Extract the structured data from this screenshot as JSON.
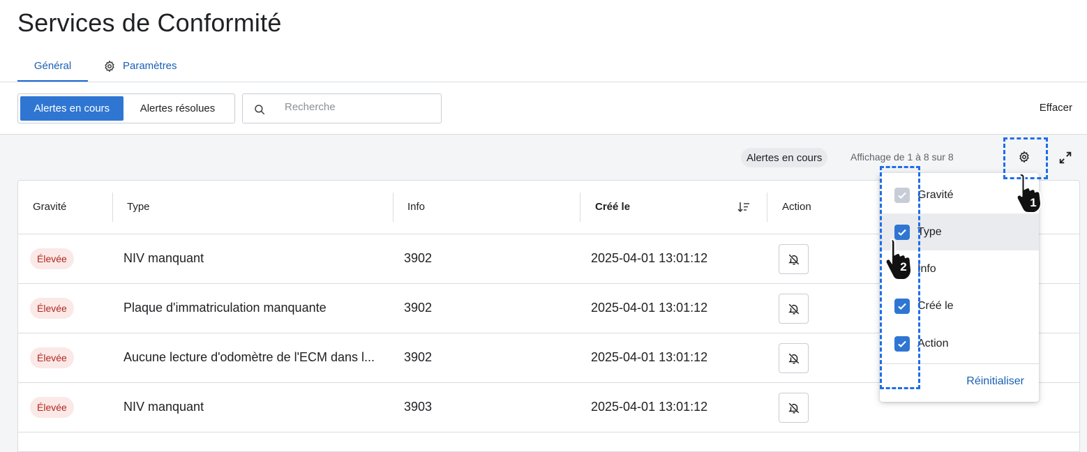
{
  "page": {
    "title": "Services de Conformité"
  },
  "tabs": [
    {
      "label": "Général",
      "active": true
    },
    {
      "label": "Paramètres",
      "icon": "gear-icon"
    }
  ],
  "toolbar": {
    "seg_active": "Alertes en cours",
    "seg_other": "Alertes résolues",
    "search_placeholder": "Recherche",
    "search_icon": "search-icon",
    "clear_label": "Effacer"
  },
  "table_bar": {
    "chip": "Alertes en cours",
    "count": "Affichage de 1 à 8 sur 8",
    "settings_icon": "gear-icon",
    "expand_icon": "expand-icon"
  },
  "table": {
    "headers": [
      "Gravité",
      "Type",
      "Info",
      "Créé le",
      "Action"
    ],
    "sorted_column": "Créé le",
    "rows": [
      {
        "severity": "Élevée",
        "type": "NIV manquant",
        "info": "3902",
        "created": "2025-04-01 13:01:12"
      },
      {
        "severity": "Élevée",
        "type": "Plaque d'immatriculation manquante",
        "info": "3902",
        "created": "2025-04-01 13:01:12"
      },
      {
        "severity": "Élevée",
        "type": "Aucune lecture d'odomètre de l'ECM dans l...",
        "info": "3902",
        "created": "2025-04-01 13:01:12"
      },
      {
        "severity": "Élevée",
        "type": "NIV manquant",
        "info": "3903",
        "created": "2025-04-01 13:01:12"
      }
    ],
    "row_action_icon": "bell-off-icon"
  },
  "columns_menu": {
    "options": [
      {
        "label": "Gravité",
        "checked": true,
        "disabled": true
      },
      {
        "label": "Type",
        "checked": true,
        "highlighted": true
      },
      {
        "label": "Info",
        "checked": false
      },
      {
        "label": "Créé le",
        "checked": true
      },
      {
        "label": "Action",
        "checked": true
      }
    ],
    "reset_label": "Réinitialiser"
  },
  "annotations": {
    "step1": "1",
    "step2": "2",
    "highlight_color": "#1e6ee8"
  },
  "colors": {
    "accent": "#2f76d2",
    "link": "#1a5fb4",
    "severity_bg": "#fbe9e7",
    "severity_text": "#b3261e"
  }
}
